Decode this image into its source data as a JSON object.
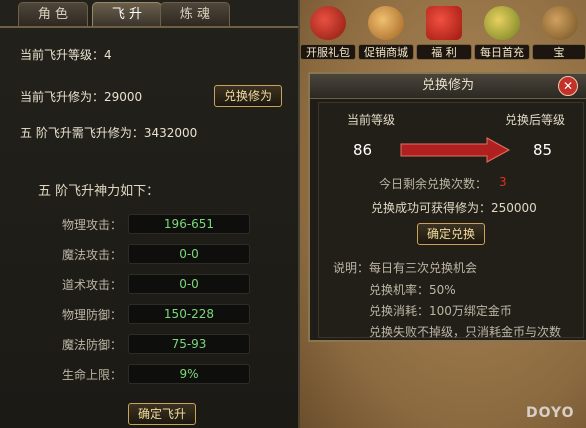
{
  "tabs": [
    {
      "label": "角 色"
    },
    {
      "label": "飞 升"
    },
    {
      "label": "炼 魂"
    }
  ],
  "ascension": {
    "current_level_label": "当前飞升等级：4",
    "current_cultivation_label": "当前飞升修为：29000",
    "exchange_button": "兑换修为",
    "required_label": "五 阶飞升需飞升修为：3432000",
    "power_title": "五 阶飞升神力如下：",
    "stats": [
      {
        "label": "物理攻击：",
        "value": "196-651"
      },
      {
        "label": "魔法攻击：",
        "value": "0-0"
      },
      {
        "label": "道术攻击：",
        "value": "0-0"
      },
      {
        "label": "物理防御：",
        "value": "150-228"
      },
      {
        "label": "魔法防御：",
        "value": "75-93"
      },
      {
        "label": "生命上限：",
        "value": "9%"
      }
    ],
    "confirm_button": "确定飞升"
  },
  "top_icons": [
    {
      "label": "开服礼包",
      "icon": "gift-pack-icon"
    },
    {
      "label": "促销商城",
      "icon": "shop-bag-icon"
    },
    {
      "label": "福 利",
      "icon": "red-envelope-icon"
    },
    {
      "label": "每日首充",
      "icon": "money-bag-icon"
    },
    {
      "label": "宝",
      "icon": "treasure-icon"
    }
  ],
  "dialog": {
    "title": "兑换修为",
    "current_level_label": "当前等级",
    "after_level_label": "兑换后等级",
    "current_level": "86",
    "after_level": "85",
    "remaining_label": "今日剩余兑换次数：",
    "remaining_count": "3",
    "gain_label": "兑换成功可获得修为：250000",
    "confirm_button": "确定兑换",
    "notes": [
      "说明：每日有三次兑换机会",
      "兑换机率：50%",
      "兑换消耗：100万绑定金币",
      "兑换失败不掉级，只消耗金币与次数"
    ]
  },
  "colors": {
    "stat_value": "#7dd87a",
    "remaining": "#e03020",
    "arrow": "#b02020",
    "button_border": "#c9a35a"
  },
  "watermark": "DOYO"
}
